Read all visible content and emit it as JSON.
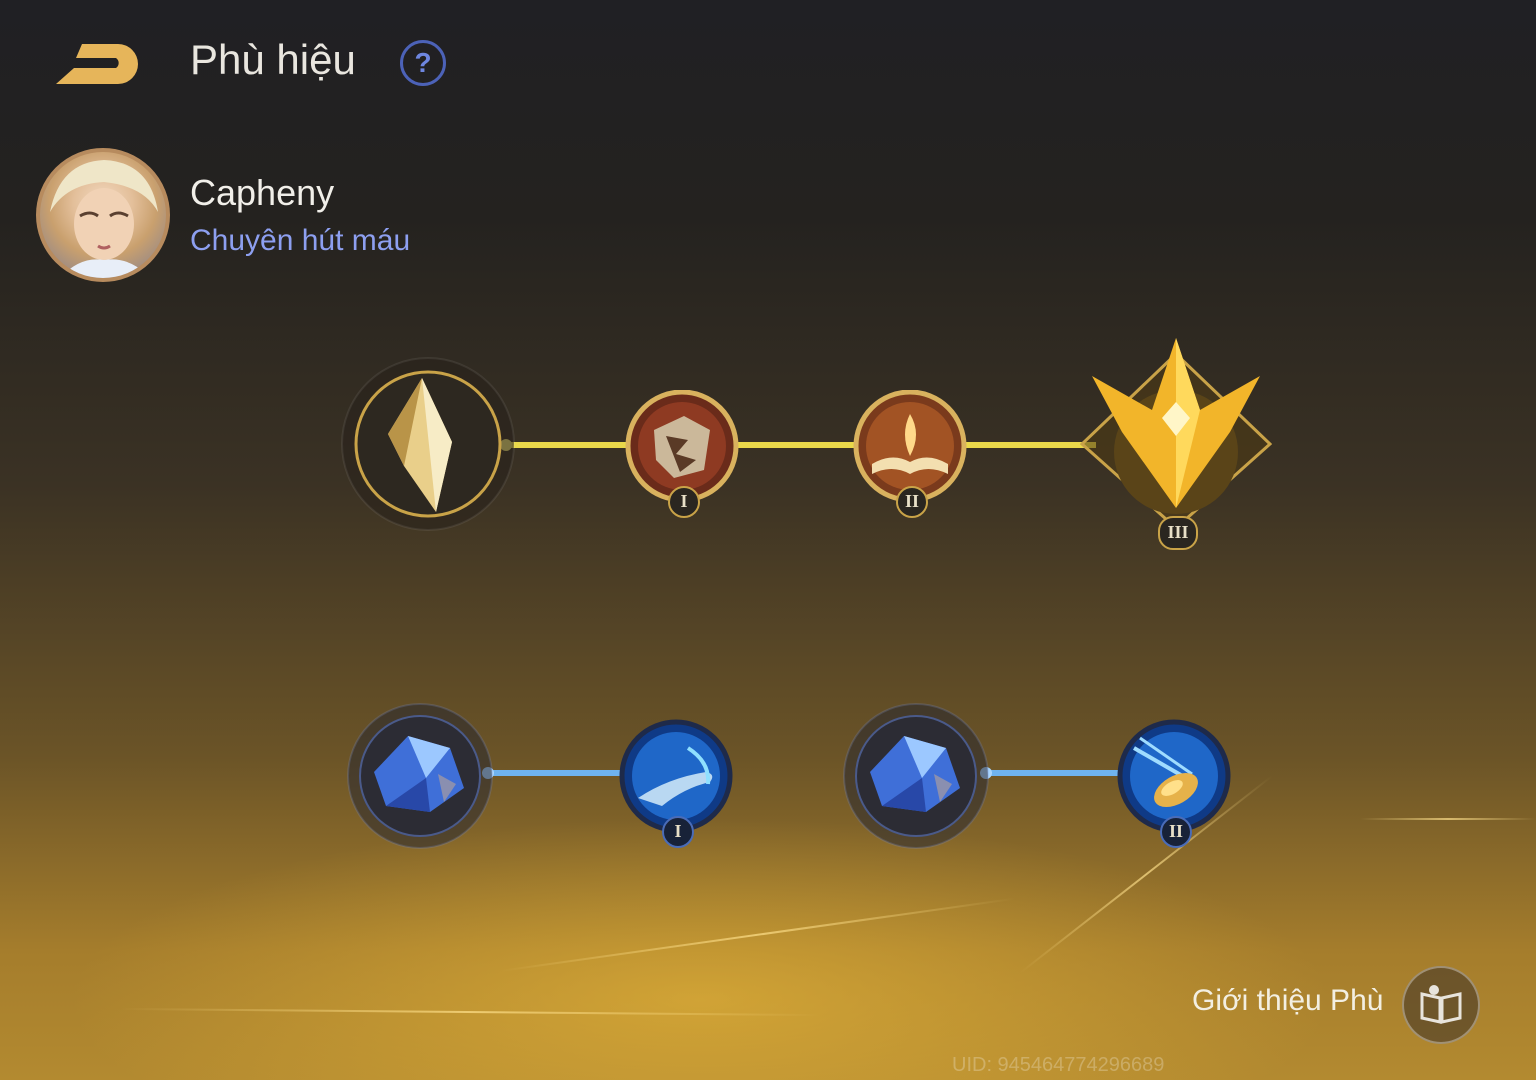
{
  "header": {
    "title": "Phù hiệu",
    "help_icon": "question-circle-icon",
    "back_icon": "back-arrow-icon"
  },
  "hero": {
    "name": "Capheny",
    "set_name": "Chuyên hút máu"
  },
  "primary_tree": {
    "color": "#e9d84a",
    "nodes": [
      {
        "name": "gold-crystal-icon",
        "level": ""
      },
      {
        "name": "shattered-shield-icon",
        "level": "I"
      },
      {
        "name": "open-book-icon",
        "level": "II"
      },
      {
        "name": "golden-crest-icon",
        "level": "III"
      }
    ]
  },
  "secondary_tree": {
    "color": "#6fb3f0",
    "nodes": [
      {
        "name": "blue-crystal-icon",
        "level": ""
      },
      {
        "name": "reaching-hand-icon",
        "level": "I"
      },
      {
        "name": "blue-crystal-icon",
        "level": ""
      },
      {
        "name": "golden-shell-icon",
        "level": "II"
      }
    ]
  },
  "footer": {
    "intro_label": "Giới thiệu Phù",
    "intro_icon": "book-guide-icon",
    "uid": "UID: 945464774296689"
  }
}
